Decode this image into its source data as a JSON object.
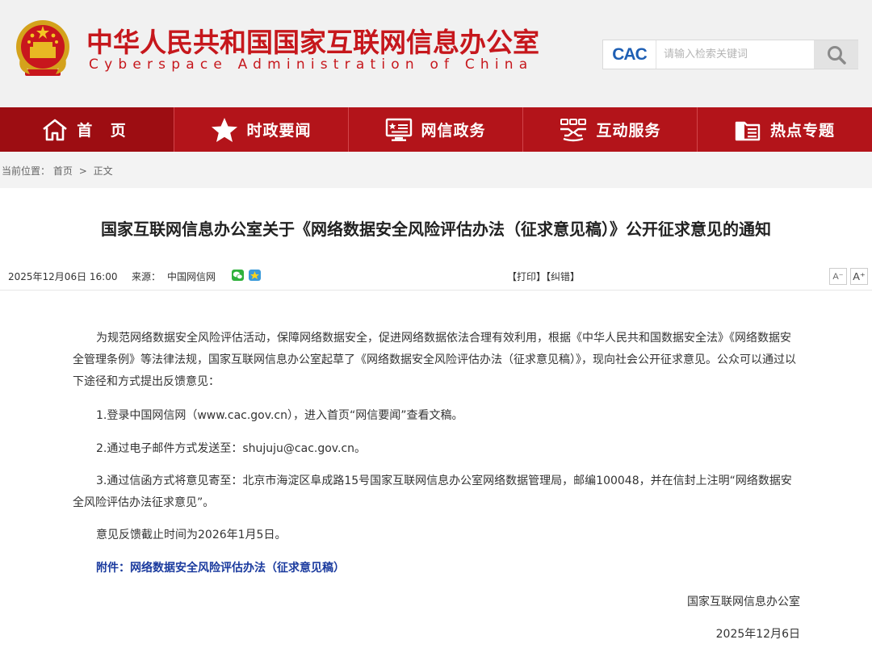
{
  "header": {
    "title_cn": "中华人民共和国国家互联网信息办公室",
    "title_en": "Cyberspace Administration of China",
    "logo_text": "CAC",
    "search_placeholder": "请输入检索关键词",
    "brand_color": "#c6171c"
  },
  "nav": {
    "items": [
      {
        "label": "首 页",
        "icon": "home-icon"
      },
      {
        "label": "时政要闻",
        "icon": "star-icon"
      },
      {
        "label": "网信政务",
        "icon": "monitor-icon"
      },
      {
        "label": "互动服务",
        "icon": "handshake-icon"
      },
      {
        "label": "热点专题",
        "icon": "folder-icon"
      }
    ],
    "bg_color": "#b3141a"
  },
  "breadcrumb": {
    "prefix": "当前位置：",
    "home": "首页",
    "separator": ">",
    "current": "正文"
  },
  "article": {
    "title": "国家互联网信息办公室关于《网络数据安全风险评估办法（征求意见稿）》公开征求意见的通知",
    "date": "2025年12月06日 16:00",
    "source_label": "来源：",
    "source": "中国网信网",
    "print": "【打印】",
    "correct": "【纠错】",
    "font_small": "A⁻",
    "font_large": "A⁺",
    "paragraphs": [
      "为规范网络数据安全风险评估活动，保障网络数据安全，促进网络数据依法合理有效利用，根据《中华人民共和国数据安全法》《网络数据安全管理条例》等法律法规，国家互联网信息办公室起草了《网络数据安全风险评估办法（征求意见稿）》，现向社会公开征求意见。公众可以通过以下途径和方式提出反馈意见：",
      "1.登录中国网信网（www.cac.gov.cn），进入首页“网信要闻”查看文稿。",
      "2.通过电子邮件方式发送至：shujuju@cac.gov.cn。",
      "3.通过信函方式将意见寄至：北京市海淀区阜成路15号国家互联网信息办公室网络数据管理局，邮编100048，并在信封上注明“网络数据安全风险评估办法征求意见”。",
      "意见反馈截止时间为2026年1月5日。"
    ],
    "attachment": "附件：网络数据安全风险评估办法（征求意见稿）",
    "signature_org": "国家互联网信息办公室",
    "signature_date": "2025年12月6日"
  }
}
